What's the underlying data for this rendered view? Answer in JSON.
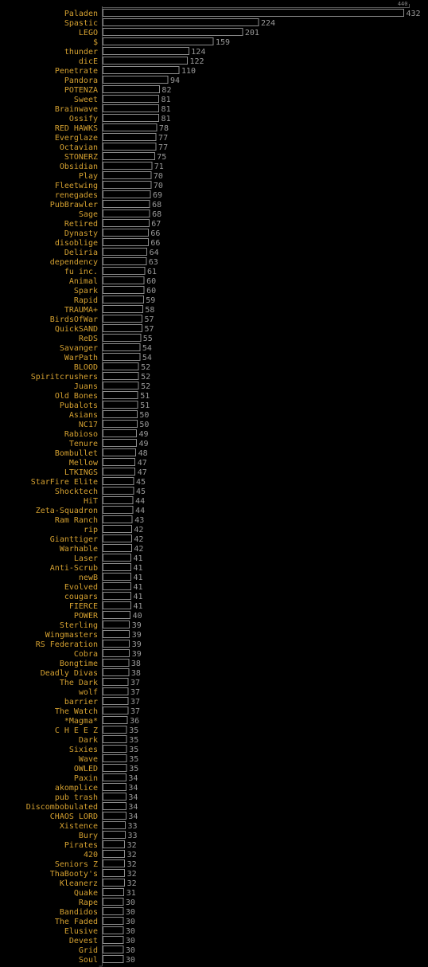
{
  "chart_data": {
    "type": "bar",
    "orientation": "horizontal",
    "title": "",
    "xlabel": "",
    "ylabel": "",
    "xlim": [
      0,
      440
    ],
    "x_ticks": [
      440
    ],
    "grid": false,
    "colors": {
      "background": "#000000",
      "label": "#d4a030",
      "value": "#9a9a9a",
      "bar_outline": "#8c8c8c",
      "axis": "#555555"
    },
    "categories": [
      "Paladen",
      "Spastic",
      "LEGO",
      "$",
      "thunder",
      "dicE",
      "Penetrate",
      "Pandora",
      "POTENZA",
      "Sweet",
      "Brainwave",
      "Ossify",
      "RED HAWKS",
      "Everglaze",
      "Octavian",
      "STONERZ",
      "Obsidian",
      "Play",
      "Fleetwing",
      "renegades",
      "PubBrawler",
      "Sage",
      "Retired",
      "Dynasty",
      "disoblige",
      "Deliria",
      "dependency",
      "fu inc.",
      "Animal",
      "Spark",
      "Rapid",
      "TRAUMA+",
      "BirdsOfWar",
      "QuickSAND",
      "ReDS",
      "Savanger",
      "WarPath",
      "BLOOD",
      "Spiritcrushers",
      "Juans",
      "Old Bones",
      "Pubalots",
      "Asians",
      "NC17",
      "Rabioso",
      "Tenure",
      "Bombullet",
      "Mellow",
      "LTKINGS",
      "StarFire Elite",
      "Shocktech",
      "HiT",
      "Zeta-Squadron",
      "Ram Ranch",
      "rip",
      "Gianttiger",
      "Warhable",
      "Laser",
      "Anti-Scrub",
      "newB",
      "Evolved",
      "cougars",
      "FIERCE",
      "POWER",
      "Sterling",
      "Wingmasters",
      "RS Federation",
      "Cobra",
      "Bongtime",
      "Deadly Divas",
      "The Dark",
      "wolf",
      "barrier",
      "The Watch",
      "*Magma*",
      "C H E E Z",
      "Dark",
      "Sixies",
      "Wave",
      "OWLED",
      "Paxin",
      "akomplice",
      "pub trash",
      "Discombobulated",
      "CHAOS LORD",
      "Xistence",
      "Bury",
      "Pirates",
      "420",
      "Seniors Z",
      "ThaBooty's",
      "Kleanerz",
      "Quake",
      "Rape",
      "Bandidos",
      "The Faded",
      "Elusive",
      "Devest",
      "Grid",
      "Soul"
    ],
    "values": [
      432,
      224,
      201,
      159,
      124,
      122,
      110,
      94,
      82,
      81,
      81,
      81,
      78,
      77,
      77,
      75,
      71,
      70,
      70,
      69,
      68,
      68,
      67,
      66,
      66,
      64,
      63,
      61,
      60,
      60,
      59,
      58,
      57,
      57,
      55,
      54,
      54,
      52,
      52,
      52,
      51,
      51,
      50,
      50,
      49,
      49,
      48,
      47,
      47,
      45,
      45,
      44,
      44,
      43,
      42,
      42,
      42,
      41,
      41,
      41,
      41,
      41,
      41,
      40,
      39,
      39,
      39,
      39,
      38,
      38,
      37,
      37,
      37,
      37,
      36,
      35,
      35,
      35,
      35,
      35,
      34,
      34,
      34,
      34,
      34,
      33,
      33,
      32,
      32,
      32,
      32,
      32,
      31,
      30,
      30,
      30,
      30,
      30,
      30,
      30
    ]
  }
}
